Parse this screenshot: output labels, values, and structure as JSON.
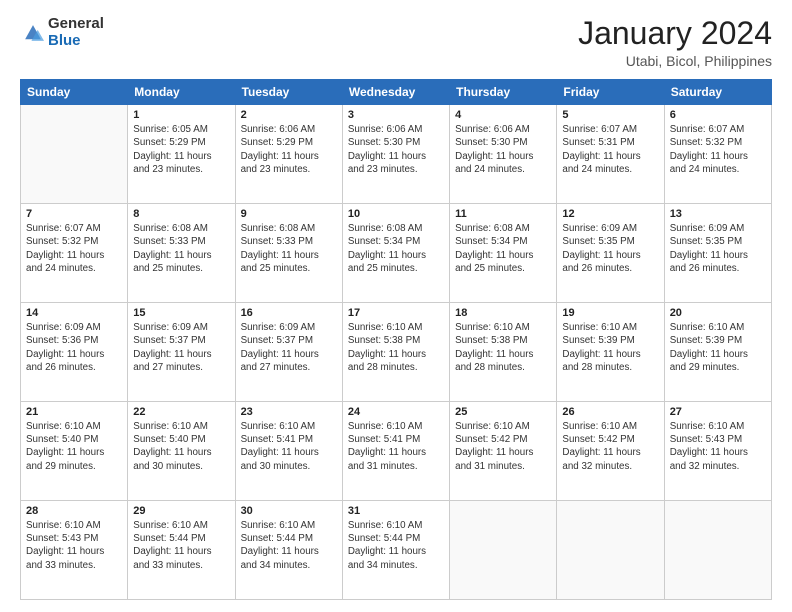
{
  "logo": {
    "general": "General",
    "blue": "Blue"
  },
  "header": {
    "title": "January 2024",
    "subtitle": "Utabi, Bicol, Philippines"
  },
  "days_of_week": [
    "Sunday",
    "Monday",
    "Tuesday",
    "Wednesday",
    "Thursday",
    "Friday",
    "Saturday"
  ],
  "weeks": [
    [
      {
        "day": "",
        "info": ""
      },
      {
        "day": "1",
        "info": "Sunrise: 6:05 AM\nSunset: 5:29 PM\nDaylight: 11 hours\nand 23 minutes."
      },
      {
        "day": "2",
        "info": "Sunrise: 6:06 AM\nSunset: 5:29 PM\nDaylight: 11 hours\nand 23 minutes."
      },
      {
        "day": "3",
        "info": "Sunrise: 6:06 AM\nSunset: 5:30 PM\nDaylight: 11 hours\nand 23 minutes."
      },
      {
        "day": "4",
        "info": "Sunrise: 6:06 AM\nSunset: 5:30 PM\nDaylight: 11 hours\nand 24 minutes."
      },
      {
        "day": "5",
        "info": "Sunrise: 6:07 AM\nSunset: 5:31 PM\nDaylight: 11 hours\nand 24 minutes."
      },
      {
        "day": "6",
        "info": "Sunrise: 6:07 AM\nSunset: 5:32 PM\nDaylight: 11 hours\nand 24 minutes."
      }
    ],
    [
      {
        "day": "7",
        "info": "Sunrise: 6:07 AM\nSunset: 5:32 PM\nDaylight: 11 hours\nand 24 minutes."
      },
      {
        "day": "8",
        "info": "Sunrise: 6:08 AM\nSunset: 5:33 PM\nDaylight: 11 hours\nand 25 minutes."
      },
      {
        "day": "9",
        "info": "Sunrise: 6:08 AM\nSunset: 5:33 PM\nDaylight: 11 hours\nand 25 minutes."
      },
      {
        "day": "10",
        "info": "Sunrise: 6:08 AM\nSunset: 5:34 PM\nDaylight: 11 hours\nand 25 minutes."
      },
      {
        "day": "11",
        "info": "Sunrise: 6:08 AM\nSunset: 5:34 PM\nDaylight: 11 hours\nand 25 minutes."
      },
      {
        "day": "12",
        "info": "Sunrise: 6:09 AM\nSunset: 5:35 PM\nDaylight: 11 hours\nand 26 minutes."
      },
      {
        "day": "13",
        "info": "Sunrise: 6:09 AM\nSunset: 5:35 PM\nDaylight: 11 hours\nand 26 minutes."
      }
    ],
    [
      {
        "day": "14",
        "info": "Sunrise: 6:09 AM\nSunset: 5:36 PM\nDaylight: 11 hours\nand 26 minutes."
      },
      {
        "day": "15",
        "info": "Sunrise: 6:09 AM\nSunset: 5:37 PM\nDaylight: 11 hours\nand 27 minutes."
      },
      {
        "day": "16",
        "info": "Sunrise: 6:09 AM\nSunset: 5:37 PM\nDaylight: 11 hours\nand 27 minutes."
      },
      {
        "day": "17",
        "info": "Sunrise: 6:10 AM\nSunset: 5:38 PM\nDaylight: 11 hours\nand 28 minutes."
      },
      {
        "day": "18",
        "info": "Sunrise: 6:10 AM\nSunset: 5:38 PM\nDaylight: 11 hours\nand 28 minutes."
      },
      {
        "day": "19",
        "info": "Sunrise: 6:10 AM\nSunset: 5:39 PM\nDaylight: 11 hours\nand 28 minutes."
      },
      {
        "day": "20",
        "info": "Sunrise: 6:10 AM\nSunset: 5:39 PM\nDaylight: 11 hours\nand 29 minutes."
      }
    ],
    [
      {
        "day": "21",
        "info": "Sunrise: 6:10 AM\nSunset: 5:40 PM\nDaylight: 11 hours\nand 29 minutes."
      },
      {
        "day": "22",
        "info": "Sunrise: 6:10 AM\nSunset: 5:40 PM\nDaylight: 11 hours\nand 30 minutes."
      },
      {
        "day": "23",
        "info": "Sunrise: 6:10 AM\nSunset: 5:41 PM\nDaylight: 11 hours\nand 30 minutes."
      },
      {
        "day": "24",
        "info": "Sunrise: 6:10 AM\nSunset: 5:41 PM\nDaylight: 11 hours\nand 31 minutes."
      },
      {
        "day": "25",
        "info": "Sunrise: 6:10 AM\nSunset: 5:42 PM\nDaylight: 11 hours\nand 31 minutes."
      },
      {
        "day": "26",
        "info": "Sunrise: 6:10 AM\nSunset: 5:42 PM\nDaylight: 11 hours\nand 32 minutes."
      },
      {
        "day": "27",
        "info": "Sunrise: 6:10 AM\nSunset: 5:43 PM\nDaylight: 11 hours\nand 32 minutes."
      }
    ],
    [
      {
        "day": "28",
        "info": "Sunrise: 6:10 AM\nSunset: 5:43 PM\nDaylight: 11 hours\nand 33 minutes."
      },
      {
        "day": "29",
        "info": "Sunrise: 6:10 AM\nSunset: 5:44 PM\nDaylight: 11 hours\nand 33 minutes."
      },
      {
        "day": "30",
        "info": "Sunrise: 6:10 AM\nSunset: 5:44 PM\nDaylight: 11 hours\nand 34 minutes."
      },
      {
        "day": "31",
        "info": "Sunrise: 6:10 AM\nSunset: 5:44 PM\nDaylight: 11 hours\nand 34 minutes."
      },
      {
        "day": "",
        "info": ""
      },
      {
        "day": "",
        "info": ""
      },
      {
        "day": "",
        "info": ""
      }
    ]
  ]
}
